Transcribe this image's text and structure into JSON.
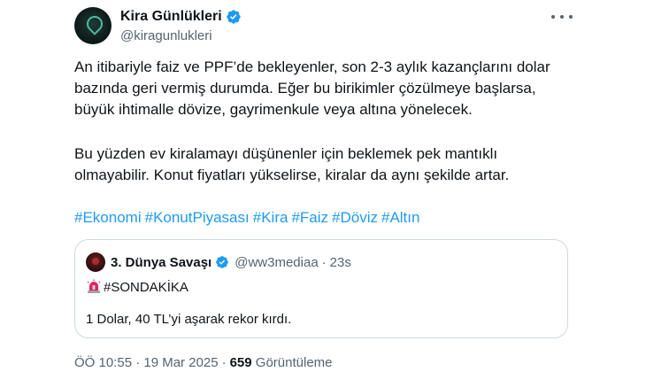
{
  "author": {
    "display_name": "Kira Günlükleri",
    "handle": "@kiragunlukleri",
    "verified": true
  },
  "post": {
    "paragraph1": [
      "An itibariyle faiz ve PPF’de bekleyenler, son 2-3 aylık kazançlarını dolar",
      "bazında geri vermiş durumda. Eğer bu birikimler çözülmeye başlarsa,",
      "büyük ihtimalle dövize, gayrimenkule veya altına yönelecek."
    ],
    "paragraph2": [
      "Bu yüzden ev kiralamayı düşünenler için beklemek pek mantıklı",
      "olmayabilir. Konut fiyatları yükselirse, kiralar da aynı şekilde artar."
    ],
    "hashtags": [
      "#Ekonomi",
      "#KonutPiyasası",
      "#Kira",
      "#Faiz",
      "#Döviz",
      "#Altın"
    ]
  },
  "quote": {
    "display_name": "3. Dünya Savaşı",
    "handle": "@ww3mediaa",
    "separator": "·",
    "time": "23s",
    "line1": "#SONDAKİKA",
    "line2": "1 Dolar, 40 TL’yi aşarak rekor kırdı."
  },
  "meta": {
    "timestamp": "ÖÖ 10:55 · 19 Mar 2025",
    "separator": "·",
    "views_count": "659",
    "views_label": "Görüntüleme"
  },
  "colors": {
    "text": "#0f1419",
    "secondary": "#536471",
    "link": "#1d9bf0",
    "border": "#cfd9de",
    "verified": "#1d9bf0"
  },
  "icons": {
    "verified": "verified-badge-icon",
    "more": "more-options-icon",
    "siren": "rotating-light-emoji-icon"
  }
}
